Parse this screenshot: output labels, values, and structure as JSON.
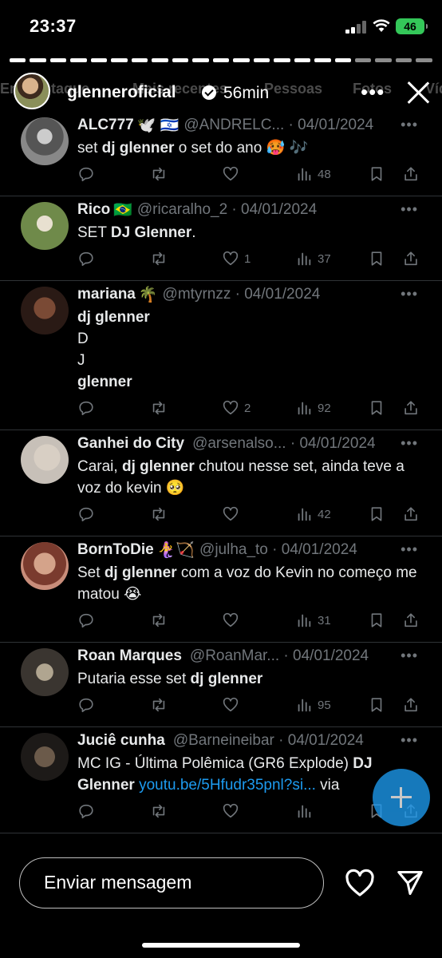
{
  "status_bar": {
    "time": "23:37",
    "battery": "46"
  },
  "story": {
    "username": "glenneroficial",
    "time_ago": "56min",
    "background_tabs": [
      "Em destaque",
      "Mais recentes",
      "Pessoas",
      "Fotos",
      "Víd"
    ]
  },
  "tweets": [
    {
      "name": "ALC777",
      "emoji": "🕊️ 🇮🇱",
      "handle": "@ANDRELC...",
      "date": "04/01/2024",
      "text_html": "set <b>dj glenner</b> o set do ano 🥵 🎶",
      "likes": "",
      "views": "48"
    },
    {
      "name": "Rico",
      "emoji": "🇧🇷",
      "handle": "@ricaralho_2",
      "date": "04/01/2024",
      "text_html": "SET <b>DJ Glenner</b>.",
      "likes": "1",
      "views": "37"
    },
    {
      "name": "mariana",
      "emoji": "🌴",
      "handle": "@mtyrnzz",
      "date": "04/01/2024",
      "text_html": "<b>dj glenner</b><br>D<br>J<br><b>glenner</b>",
      "likes": "2",
      "views": "92"
    },
    {
      "name": "Ganhei do City",
      "emoji": "",
      "handle": "@arsenalso...",
      "date": "04/01/2024",
      "text_html": "Carai, <b>dj glenner</b> chutou nesse set, ainda teve a voz do kevin 🥺",
      "likes": "",
      "views": "42"
    },
    {
      "name": "BornToDie",
      "emoji": "🧜‍♀️🏹",
      "handle": "@julha_to",
      "date": "04/01/2024",
      "text_html": "Set <b>dj glenner</b> com a voz do Kevin no começo me matou 😭",
      "likes": "",
      "views": "31"
    },
    {
      "name": "Roan Marques",
      "emoji": "",
      "handle": "@RoanMar...",
      "date": "04/01/2024",
      "text_html": "Putaria esse set <b>dj glenner</b>",
      "likes": "",
      "views": "95"
    },
    {
      "name": "Juciê cunha",
      "emoji": "",
      "handle": "@Barneineibar",
      "date": "04/01/2024",
      "text_html": "MC IG - Última Polêmica (GR6 Explode) <b>DJ Glenner</b> <span class=\"link\">youtu.be/5Hfudr35pnl?si...</span> via",
      "likes": "",
      "views": ""
    }
  ],
  "colors": {
    "link": "#1d9bf0",
    "muted": "#71767b",
    "divider": "#2f3336",
    "battery": "#34c759"
  },
  "bottom_bar": {
    "message_placeholder": "Enviar mensagem"
  }
}
